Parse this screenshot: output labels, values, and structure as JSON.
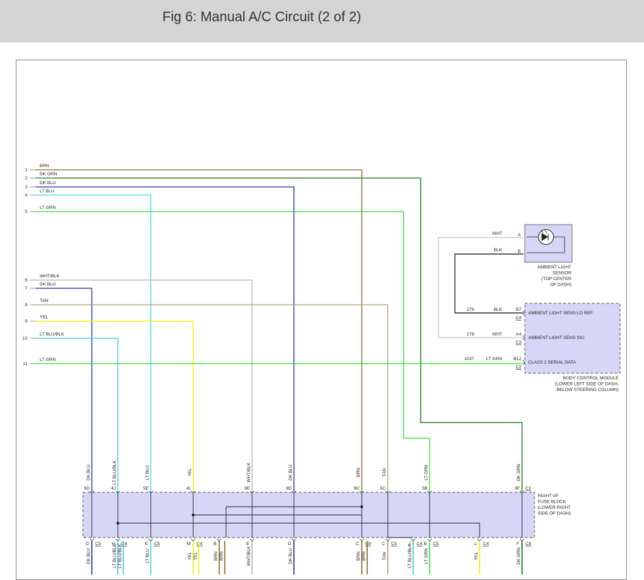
{
  "title": "Fig 6: Manual A/C Circuit (2 of 2)",
  "colors": {
    "BRN": "#8a6a22",
    "DK GRN": "#0d7a0d",
    "DK BLU": "#1b2fa6",
    "LT BLU": "#3fd6e6",
    "LT GRN": "#2ee02e",
    "WHT/BLK": "#b4b4b4",
    "TAN": "#b39e79",
    "YEL": "#f0f000",
    "LT BLU/BLK": "#3fc8d8",
    "WHT": "#c6c6c6",
    "BLK": "#333333",
    "module_fill": "#d6d6f7"
  },
  "wires": [
    {
      "num": "1",
      "color": "BRN",
      "label": "BRN",
      "fuse_label": "BRN",
      "pin": "8C"
    },
    {
      "num": "2",
      "color": "DK GRN",
      "label": "DK GRN",
      "fuse_label": "DK GRN",
      "pin": "8F",
      "conn": "C1"
    },
    {
      "num": "3",
      "color": "DK BLU",
      "label": "DK BLU",
      "fuse_label": "DK BLU",
      "pin": "8D"
    },
    {
      "num": "4",
      "color": "LT BLU",
      "label": "LT BLU",
      "fuse_label": "LT BLU",
      "pin": "5E"
    },
    {
      "num": "5",
      "color": "LT GRN",
      "label": "LT GRN",
      "fuse_label": "LT GRN",
      "pin": "5B"
    },
    {
      "num": "6",
      "color": "WHT/BLK",
      "label": "WHT/BLK",
      "fuse_label": "WHT/BLK",
      "pin": "8E"
    },
    {
      "num": "7",
      "color": "DK BLU",
      "label": "DK BLU",
      "fuse_label": "DK BLU",
      "pin": "5D"
    },
    {
      "num": "8",
      "color": "TAN",
      "label": "TAN",
      "fuse_label": "TAN",
      "pin": "5C"
    },
    {
      "num": "9",
      "color": "YEL",
      "label": "YEL",
      "fuse_label": "YEL",
      "pin": "4L"
    },
    {
      "num": "10",
      "color": "LT BLU/BLK",
      "label": "LT BLU/BLK",
      "fuse_label": "LT BLU/BLK",
      "pin": "4J"
    },
    {
      "num": "11",
      "color": "LT GRN",
      "label": "LT GRN"
    }
  ],
  "ambient_sensor": {
    "name_lines": [
      "AMBIENT LIGHT",
      "SENSOR",
      "(TOP CENTER",
      "OF DASH)"
    ],
    "pins": [
      {
        "pin": "A",
        "wire_color": "WHT",
        "label": "WHT"
      },
      {
        "pin": "B",
        "wire_color": "BLK",
        "label": "BLK"
      }
    ]
  },
  "bcm": {
    "name_lines": [
      "BODY CONTROL MODULE",
      "(LOWER LEFT SIDE OF DASH,",
      "BELOW STEERING COLUMN)"
    ],
    "pins": [
      {
        "circuit": "279",
        "wire": "BLK",
        "pin": "B7",
        "conn": "C4",
        "signal": "AMBIENT LIGHT SENS LO REF"
      },
      {
        "circuit": "278",
        "wire": "WHT",
        "pin": "A4",
        "conn": "C3",
        "signal": "AMBIENT LIGHT SENS SIG"
      },
      {
        "circuit": "1037",
        "wire": "LT GRN",
        "pin": "B12",
        "conn": "C2",
        "signal": "CLASS 2 SERIAL DATA"
      }
    ]
  },
  "fuse_block": {
    "name_lines": [
      "RIGHT I/P",
      "FUSE BLOCK",
      "(LOWER RIGHT",
      "SIDE OF DASH)"
    ],
    "bottom_pins": [
      {
        "pin": "D",
        "conn": "C5",
        "wire": "DK BLU",
        "label": "DK BLU"
      },
      {
        "pin": "H",
        "conn": "C4",
        "wire": "LT BLU/BLK",
        "label": "LT BLU/BLK"
      },
      {
        "pin": "",
        "conn": "",
        "wire": "LT BLU/BLK",
        "label": "LT BLU/BLK"
      },
      {
        "pin": "E",
        "conn": "C5",
        "wire": "LT BLU",
        "label": "LT BLU"
      },
      {
        "pin": "M",
        "conn": "C4",
        "wire": "YEL",
        "label": "YEL"
      },
      {
        "pin": "",
        "conn": "",
        "wire": "YEL",
        "label": "YEL"
      },
      {
        "pin": "B",
        "conn": "",
        "wire": "BRN",
        "label": "BRN"
      },
      {
        "pin": "",
        "conn": "",
        "wire": "BRN",
        "label": "BRN"
      },
      {
        "pin": "E",
        "conn": "",
        "wire": "WHT/BLK",
        "label": "WHT/BLK"
      },
      {
        "pin": "D",
        "conn": "",
        "wire": "DK BLU",
        "label": "DK BLU"
      },
      {
        "pin": "C",
        "conn": "C8",
        "wire": "BRN",
        "label": "BRN"
      },
      {
        "pin": "",
        "conn": "",
        "wire": "BRN",
        "label": "BRN"
      },
      {
        "pin": "C",
        "conn": "C5",
        "wire": "TAN",
        "label": "TAN"
      },
      {
        "pin": "J",
        "conn": "C4",
        "wire": "LT BLU/BLK",
        "label": "LT BLU/BLK"
      },
      {
        "pin": "B",
        "conn": "C5",
        "wire": "LT GRN",
        "label": "LT GRN"
      },
      {
        "pin": "L",
        "conn": "C4",
        "wire": "YEL",
        "label": "YEL"
      },
      {
        "pin": "F",
        "conn": "C8",
        "wire": "DK GRN",
        "label": "DK GRN"
      }
    ]
  }
}
